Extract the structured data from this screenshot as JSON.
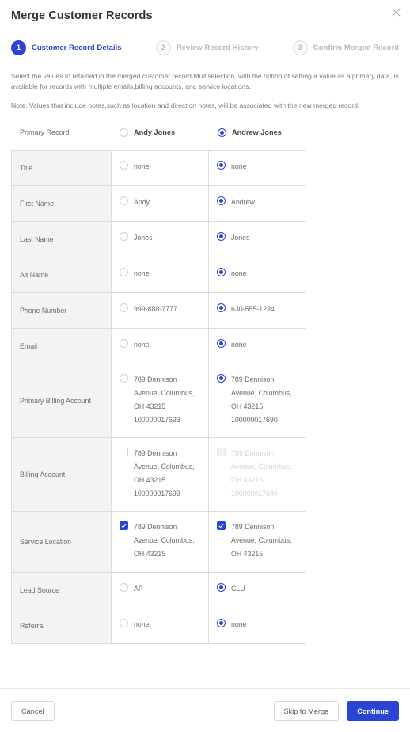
{
  "header": {
    "title": "Merge Customer Records",
    "close_icon": "close-icon"
  },
  "stepper": {
    "steps": [
      {
        "number": "1",
        "label": "Customer Record Details",
        "state": "active"
      },
      {
        "number": "2",
        "label": "Review Record History",
        "state": "inactive"
      },
      {
        "number": "3",
        "label": "Confirm Merged Record",
        "state": "inactive"
      }
    ]
  },
  "description": {
    "paragraph": "Select the values to retained in the merged customer record.Multiselection, with the option of setting a value as a primary data, is available for records with multiple emails,billing accounts, and service locations.",
    "note": "Note: Values that include notes,such as location and direction notes, will be associated with the new merged record."
  },
  "primary_record": {
    "label": "Primary Record",
    "options": [
      {
        "name": "Andy Jones",
        "selected": false
      },
      {
        "name": "Andrew Jones",
        "selected": true
      }
    ]
  },
  "accent_color": "#2a45d4",
  "table": {
    "rows": [
      {
        "label": "Title",
        "control": "radio",
        "left": {
          "value": "none",
          "selected": false,
          "disabled": false
        },
        "right": {
          "value": "none",
          "selected": true,
          "disabled": false
        }
      },
      {
        "label": "First Name",
        "control": "radio",
        "left": {
          "value": "Andy",
          "selected": false,
          "disabled": false
        },
        "right": {
          "value": "Andrew",
          "selected": true,
          "disabled": false
        }
      },
      {
        "label": "Last Name",
        "control": "radio",
        "left": {
          "value": "Jones",
          "selected": false,
          "disabled": false
        },
        "right": {
          "value": "Jones",
          "selected": true,
          "disabled": false
        }
      },
      {
        "label": "Alt Name",
        "control": "radio",
        "left": {
          "value": "none",
          "selected": false,
          "disabled": false
        },
        "right": {
          "value": "none",
          "selected": true,
          "disabled": false
        }
      },
      {
        "label": "Phone Number",
        "control": "radio",
        "left": {
          "value": "999-888-7777",
          "selected": false,
          "disabled": false
        },
        "right": {
          "value": "630-555-1234",
          "selected": true,
          "disabled": false
        }
      },
      {
        "label": "Email",
        "control": "radio",
        "left": {
          "value": "none",
          "selected": false,
          "disabled": false
        },
        "right": {
          "value": "none",
          "selected": true,
          "disabled": false
        }
      },
      {
        "label": "Primary Billing Account",
        "control": "radio",
        "height": "tall",
        "left": {
          "value": "789 Dennison Avenue, Columbus, OH 43215 100000017693",
          "selected": false,
          "disabled": false
        },
        "right": {
          "value": "789 Dennison Avenue, Columbus, OH 43215 100000017690",
          "selected": true,
          "disabled": false
        }
      },
      {
        "label": "Billing Account",
        "control": "checkbox",
        "height": "tall",
        "left": {
          "value": "789 Dennison Avenue, Columbus, OH 43215 100000017693",
          "selected": false,
          "disabled": false
        },
        "right": {
          "value": "789 Dennison Avenue, Columbus, OH 43215 100000017690",
          "selected": false,
          "disabled": true
        }
      },
      {
        "label": "Service Location",
        "control": "checkbox",
        "height": "tall2",
        "left": {
          "value": "789 Dennison Avenue, Columbus, OH 43215",
          "selected": true,
          "disabled": false
        },
        "right": {
          "value": "789 Dennison Avenue, Columbus, OH 43215",
          "selected": true,
          "disabled": false
        }
      },
      {
        "label": "Lead Source",
        "control": "radio",
        "left": {
          "value": "AP",
          "selected": false,
          "disabled": false
        },
        "right": {
          "value": "CLU",
          "selected": true,
          "disabled": false
        }
      },
      {
        "label": "Referral",
        "control": "radio",
        "left": {
          "value": "none",
          "selected": false,
          "disabled": false
        },
        "right": {
          "value": "none",
          "selected": true,
          "disabled": false
        }
      }
    ]
  },
  "footer": {
    "cancel_label": "Cancel",
    "skip_label": "Skip to Merge",
    "continue_label": "Continue"
  }
}
